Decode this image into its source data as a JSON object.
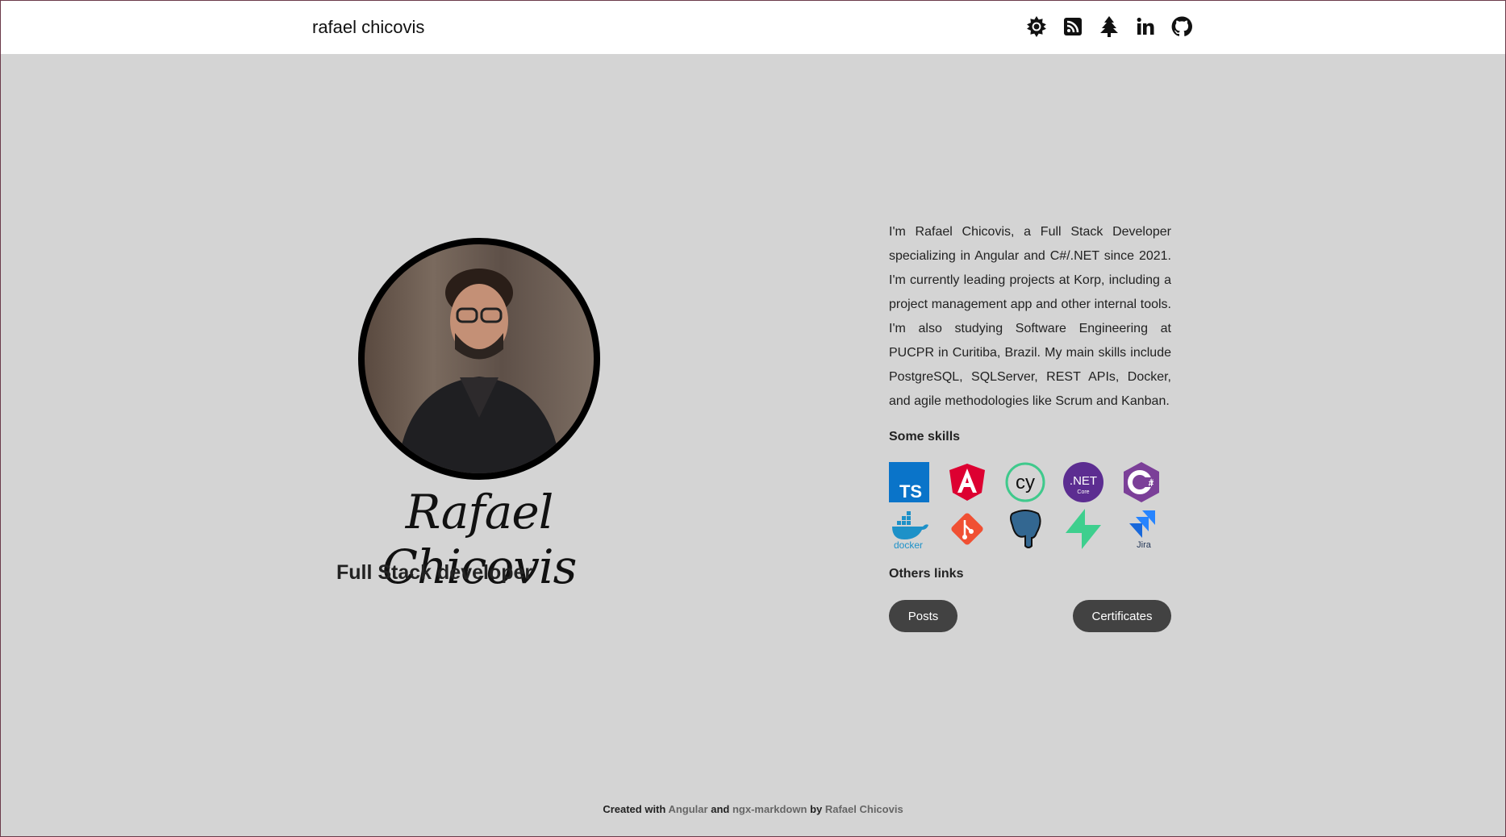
{
  "header": {
    "title": "rafael chicovis",
    "icons": [
      "theme-toggle-icon",
      "rss-icon",
      "tree-icon",
      "linkedin-icon",
      "github-icon"
    ]
  },
  "profile": {
    "signature": "Rafael Chicovis",
    "role": "Full Stack developer"
  },
  "about": "I'm Rafael Chicovis, a Full Stack Developer specializing in Angular and C#/.NET since 2021. I'm currently leading projects at Korp, including a project management app and other internal tools. I'm also studying Software Engineering at PUCPR in Curitiba, Brazil. My main skills include PostgreSQL, SQLServer, REST APIs, Docker, and agile methodologies like Scrum and Kanban.",
  "skills": {
    "heading": "Some skills",
    "ts": "TS",
    "net": ".NET",
    "net_sub": "Core",
    "cy": "cy",
    "csharp": "C#",
    "docker": "docker",
    "jira": "Jira"
  },
  "links": {
    "heading": "Others links",
    "posts": "Posts",
    "certificates": "Certificates"
  },
  "footer": {
    "created": "Created with",
    "angular": "Angular",
    "and": "and",
    "ngx": "ngx-markdown",
    "by": "by",
    "author": "Rafael Chicovis"
  },
  "colors": {
    "background": "#d4d4d4",
    "button": "#424242"
  }
}
